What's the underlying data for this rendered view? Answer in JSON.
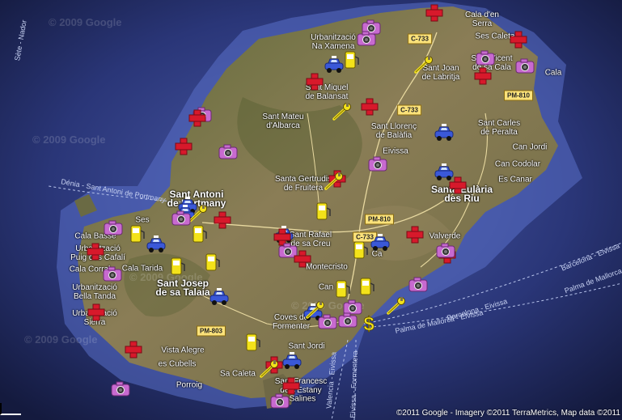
{
  "map": {
    "attribution": "©2011 Google - Imagery ©2011 TerraMetrics, Map data ©2011",
    "watermarks": [
      "2009 Google",
      "2009 Google",
      "2009 Google",
      "2009 Google",
      "2009 Google"
    ],
    "roads": [
      "C-733",
      "C-733",
      "PM-810",
      "PM-810",
      "C-733",
      "PM-803"
    ],
    "places": [
      "Cala d'en\nSerra",
      "Ses Caleta",
      "Urbanització\nNa Xamena",
      "Sant Joan\nde Labritja",
      "Sant Vicent\nde sa Cala",
      "Cala",
      "Sant Miquel\nde Balansat",
      "Sant Mateu\nd'Albarca",
      "Sant Llorenç\nde Balàfia",
      "Eivissa",
      "Sant Carles\nde Peralta",
      "Can Jordi",
      "Can Codolar",
      "Es Canar",
      "Santa Gertrudis\nde Fruitera",
      "Santa Eulària\ndes Riu",
      "Sant Antoni\nde Portmany",
      "Ses",
      "Cala Basse",
      "Urbanització\nPuig des Cafalí",
      "Cala Corral",
      "Cala Tarida",
      "Urbanització\nBella Tanda",
      "Sant Josep\nde sa Talaia",
      "Sant Rafael\nde sa Creu",
      "Montecristo",
      "Valverde",
      "Coves de\nFormenter",
      "Vista Alegre",
      "es Cubells",
      "Sant Jordi",
      "Sa Caleta",
      "Sant Francesc\nde s'Estany",
      "Porroig",
      "Salines",
      "Urbanització\nSierra",
      "Can",
      "Ca"
    ],
    "sea_labels": [
      "Sète - Nador",
      "Dénia - Sant Antoni de Portmany",
      "Barcelona - Eivissa",
      "Palma de Mallorca - E",
      "Barcelona - Eivissa",
      "Palma de Mallorca - Eivissa",
      "Valencia - Eivissa",
      "Eivissa - Formentera"
    ],
    "marker_types": [
      "hospital-icon",
      "photo-icon",
      "taxi-icon",
      "fuel-icon",
      "service-icon",
      "bank-icon"
    ]
  }
}
